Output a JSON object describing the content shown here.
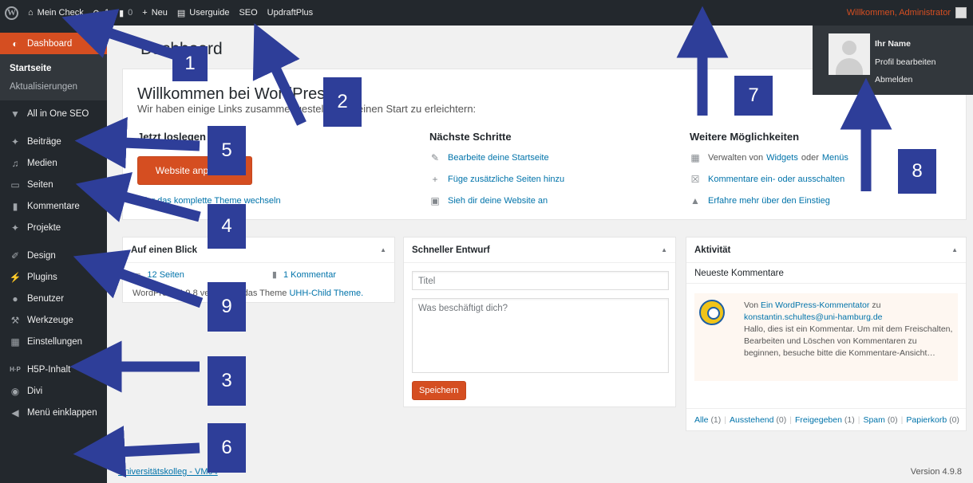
{
  "adminbar": {
    "site_name": "Mein Check",
    "updates_count": "1",
    "comments_count": "0",
    "new_label": "Neu",
    "userguide": "Userguide",
    "seo": "SEO",
    "updraft": "UpdraftPlus",
    "welcome_user": "Willkommen, Administrator"
  },
  "profile_menu": {
    "name": "Ihr Name",
    "edit": "Profil bearbeiten",
    "logout": "Abmelden"
  },
  "sidebar": {
    "dashboard": "Dashboard",
    "sub": [
      "Startseite",
      "Aktualisierungen"
    ],
    "items": [
      "All in One SEO",
      "Beiträge",
      "Medien",
      "Seiten",
      "Kommentare",
      "Projekte",
      "Design",
      "Plugins",
      "Benutzer",
      "Werkzeuge",
      "Einstellungen",
      "H5P-Inhalt",
      "Divi",
      "Menü einklappen"
    ]
  },
  "main": {
    "title": "Dashboard",
    "welcome": {
      "heading": "Willkommen bei WordPress!",
      "about": "Wir haben einige Links zusammengestellt, um deinen Start zu erleichtern:",
      "col1_title": "Jetzt loslegen",
      "button": "Website anpassen",
      "theme_link": "oder das komplette Theme wechseln",
      "col2_title": "Nächste Schritte",
      "steps": [
        "Bearbeite deine Startseite",
        "Füge zusätzliche Seiten hinzu",
        "Sieh dir deine Website an"
      ],
      "col3_title": "Weitere Möglichkeiten",
      "more_prefix": "Verwalten von",
      "more_widgets": "Widgets",
      "more_or": "oder",
      "more_menus": "Menüs",
      "more_comments": "Kommentare ein- oder ausschalten",
      "more_learn": "Erfahre mehr über den Einstieg"
    },
    "glance": {
      "title": "Auf einen Blick",
      "pages": "12 Seiten",
      "comments": "1 Kommentar",
      "theme_text": "WordPress 4.9.8 verwendet das Theme",
      "theme_name": "UHH-Child Theme."
    },
    "draft": {
      "title": "Schneller Entwurf",
      "title_placeholder": "Titel",
      "content_placeholder": "Was beschäftigt dich?",
      "save": "Speichern"
    },
    "activity": {
      "title": "Aktivität",
      "recent": "Neueste Kommentare",
      "from": "Von",
      "author": "Ein WordPress-Kommentator",
      "on": "zu",
      "post": "konstantin.schultes@uni-hamburg.de",
      "text": "Hallo, dies ist ein Kommentar. Um mit dem Freischalten, Bearbeiten und Löschen von Kommentaren zu beginnen, besuche bitte die Kommentare-Ansicht…",
      "filters": [
        {
          "label": "Alle",
          "count": "(1)"
        },
        {
          "label": "Ausstehend",
          "count": "(0)"
        },
        {
          "label": "Freigegeben",
          "count": "(1)"
        },
        {
          "label": "Spam",
          "count": "(0)"
        },
        {
          "label": "Papierkorb",
          "count": "(0)"
        }
      ]
    }
  },
  "footer": {
    "left": "Universitätskolleg - VM04",
    "right": "Version 4.9.8"
  },
  "annotations": [
    "1",
    "2",
    "3",
    "4",
    "5",
    "6",
    "7",
    "8",
    "9"
  ],
  "colors": {
    "accent": "#d54e21",
    "annotation": "#2e3e99",
    "adminbar": "#23282d"
  }
}
